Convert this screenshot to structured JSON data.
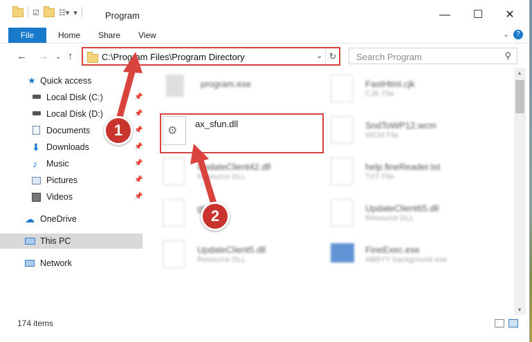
{
  "window": {
    "title": "Program",
    "minimize_icon": "minimize-icon",
    "maximize_icon": "maximize-icon",
    "close_icon": "close-icon"
  },
  "ribbon": {
    "tabs": [
      "File",
      "Home",
      "Share",
      "View"
    ],
    "accent": "#1979ca"
  },
  "navigation": {
    "back": "back-arrow-icon",
    "forward": "forward-arrow-icon",
    "up": "up-arrow-icon"
  },
  "address": {
    "path": "C:\\Program Files\\Program Directory"
  },
  "search": {
    "placeholder": "Search Program"
  },
  "sidebar": {
    "items": [
      {
        "label": "Quick access",
        "icon": "star-icon",
        "pinned": false
      },
      {
        "label": "Local Disk (C:)",
        "icon": "drive-icon",
        "pinned": true
      },
      {
        "label": "Local Disk (D:)",
        "icon": "drive-icon",
        "pinned": true
      },
      {
        "label": "Documents",
        "icon": "documents-icon",
        "pinned": true
      },
      {
        "label": "Downloads",
        "icon": "download-icon",
        "pinned": true
      },
      {
        "label": "Music",
        "icon": "music-icon",
        "pinned": true
      },
      {
        "label": "Pictures",
        "icon": "pictures-icon",
        "pinned": true
      },
      {
        "label": "Videos",
        "icon": "videos-icon",
        "pinned": true
      },
      {
        "label": "OneDrive",
        "icon": "cloud-icon",
        "pinned": false
      },
      {
        "label": "This PC",
        "icon": "computer-icon",
        "pinned": false,
        "selected": true
      },
      {
        "label": "Network",
        "icon": "network-icon",
        "pinned": false
      }
    ]
  },
  "files": [
    {
      "name": "program.exe",
      "type": ""
    },
    {
      "name": "FastHtml.cjk",
      "type": "CJK File"
    },
    {
      "name": "ax_sfun.dll",
      "type": ""
    },
    {
      "name": "SndToWP12.wcm",
      "type": "WCM File"
    },
    {
      "name": "UpdateClient42.dll",
      "type": "Resource DLL"
    },
    {
      "name": "help.fineReader.txt",
      "type": "TXT File"
    },
    {
      "name": "gt",
      "type": ""
    },
    {
      "name": "UpdateClient65.dll",
      "type": "Resource DLL"
    },
    {
      "name": "UpdateClient5.dll",
      "type": "Resource DLL"
    },
    {
      "name": "FineExec.exe",
      "type": "ABBYY background exe"
    }
  ],
  "status": {
    "count": "174 items"
  },
  "annotations": {
    "step1": "1",
    "step2": "2",
    "color": "#d9433e"
  }
}
